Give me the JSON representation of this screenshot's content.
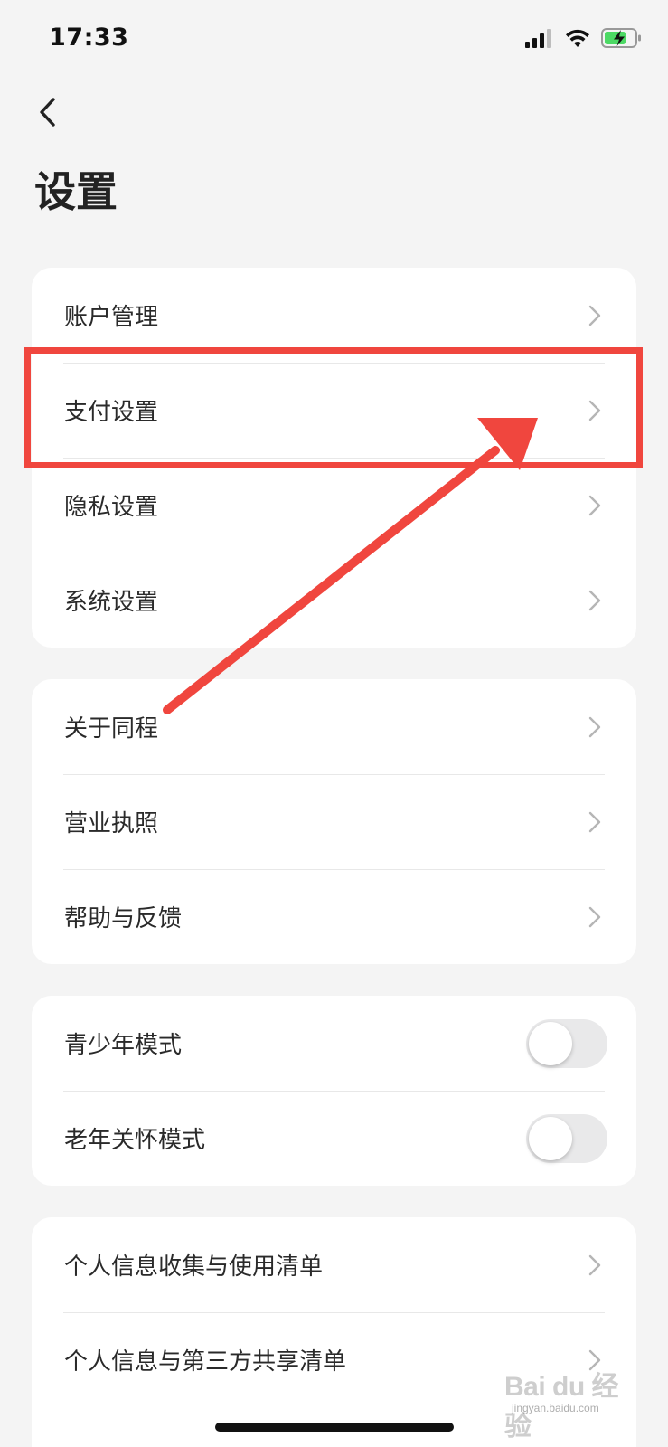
{
  "status_bar": {
    "time": "17:33",
    "icons": [
      "signal-icon",
      "wifi-icon",
      "battery-charging-icon"
    ],
    "battery_color": "#4cd964"
  },
  "header": {
    "back_icon": "chevron-left-icon",
    "title": "设置"
  },
  "groups": [
    {
      "rows": [
        {
          "label": "账户管理",
          "control": "chevron"
        },
        {
          "label": "支付设置",
          "control": "chevron"
        },
        {
          "label": "隐私设置",
          "control": "chevron"
        },
        {
          "label": "系统设置",
          "control": "chevron"
        }
      ]
    },
    {
      "rows": [
        {
          "label": "关于同程",
          "control": "chevron"
        },
        {
          "label": "营业执照",
          "control": "chevron"
        },
        {
          "label": "帮助与反馈",
          "control": "chevron"
        }
      ]
    },
    {
      "rows": [
        {
          "label": "青少年模式",
          "control": "toggle",
          "on": false
        },
        {
          "label": "老年关怀模式",
          "control": "toggle",
          "on": false
        }
      ]
    },
    {
      "rows": [
        {
          "label": "个人信息收集与使用清单",
          "control": "chevron"
        },
        {
          "label": "个人信息与第三方共享清单",
          "control": "chevron"
        }
      ]
    }
  ],
  "annotation": {
    "highlight_color": "#f0463e",
    "highlighted_row": "支付设置"
  },
  "watermark": {
    "logo_text": "Bai du 经验",
    "sub_text": "jingyan.baidu.com"
  },
  "colors": {
    "background": "#f4f4f4",
    "card": "#ffffff",
    "chevron": "#b5b5b5",
    "toggle_off": "#e9e9ea"
  }
}
